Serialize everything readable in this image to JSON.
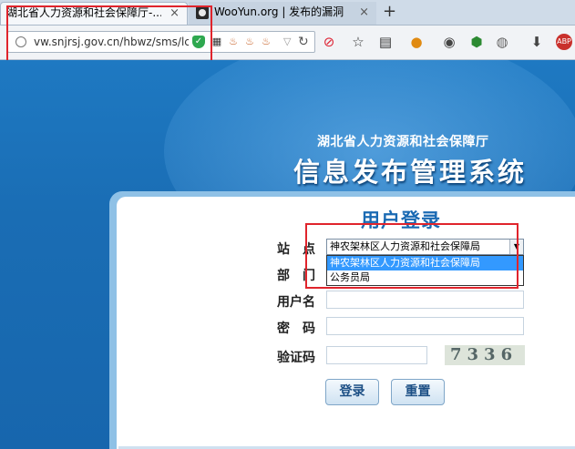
{
  "browser": {
    "tabs": [
      {
        "title": "湖北省人力资源和社会保障厅-...",
        "close": "×",
        "active": true
      },
      {
        "title": "WooYun.org | 发布的漏洞",
        "close": "×",
        "active": false
      }
    ],
    "new_tab": "+",
    "url": "vw.snjrsj.gov.cn/hbwz/sms/lc"
  },
  "header": {
    "subtitle": "湖北省人力资源和社会保障厅",
    "title": "信息发布管理系统"
  },
  "login": {
    "title": "用户登录",
    "station_label": "站　点",
    "station_value": "神农架林区人力资源和社会保障局",
    "station_options": [
      "神农架林区人力资源和社会保障局",
      "公务员局"
    ],
    "department_label": "部　门",
    "username_label": "用户名",
    "password_label": "密　码",
    "captcha_label": "验证码",
    "captcha_text": "7336",
    "login_button": "登录",
    "reset_button": "重置"
  },
  "colors": {
    "page_bg": "#1b6fb6",
    "highlight_box": "#e0242c",
    "selected_option": "#3399ff",
    "title_blue": "#1a6ab3"
  }
}
